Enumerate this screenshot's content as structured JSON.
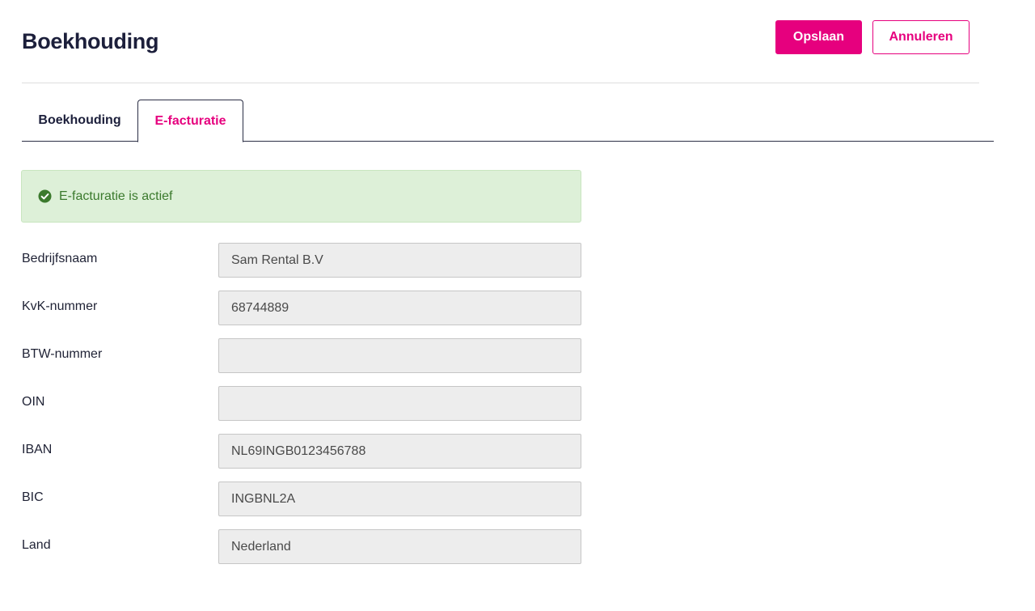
{
  "header": {
    "title": "Boekhouding",
    "save_label": "Opslaan",
    "cancel_label": "Annuleren"
  },
  "tabs": [
    {
      "label": "Boekhouding",
      "active": false
    },
    {
      "label": "E-facturatie",
      "active": true
    }
  ],
  "alert": {
    "icon": "check-circle-icon",
    "text": "E-facturatie is actief"
  },
  "form": {
    "fields": [
      {
        "label": "Bedrijfsnaam",
        "value": "Sam Rental B.V"
      },
      {
        "label": "KvK-nummer",
        "value": "68744889"
      },
      {
        "label": "BTW-nummer",
        "value": ""
      },
      {
        "label": "OIN",
        "value": ""
      },
      {
        "label": "IBAN",
        "value": "NL69INGB0123456788"
      },
      {
        "label": "BIC",
        "value": "INGBNL2A"
      },
      {
        "label": "Land",
        "value": "Nederland"
      }
    ]
  },
  "colors": {
    "accent": "#e6007e",
    "text_dark": "#1c1f3b",
    "success_bg": "#ddf0d8",
    "success_text": "#3b7a2d",
    "input_bg": "#ededed"
  }
}
